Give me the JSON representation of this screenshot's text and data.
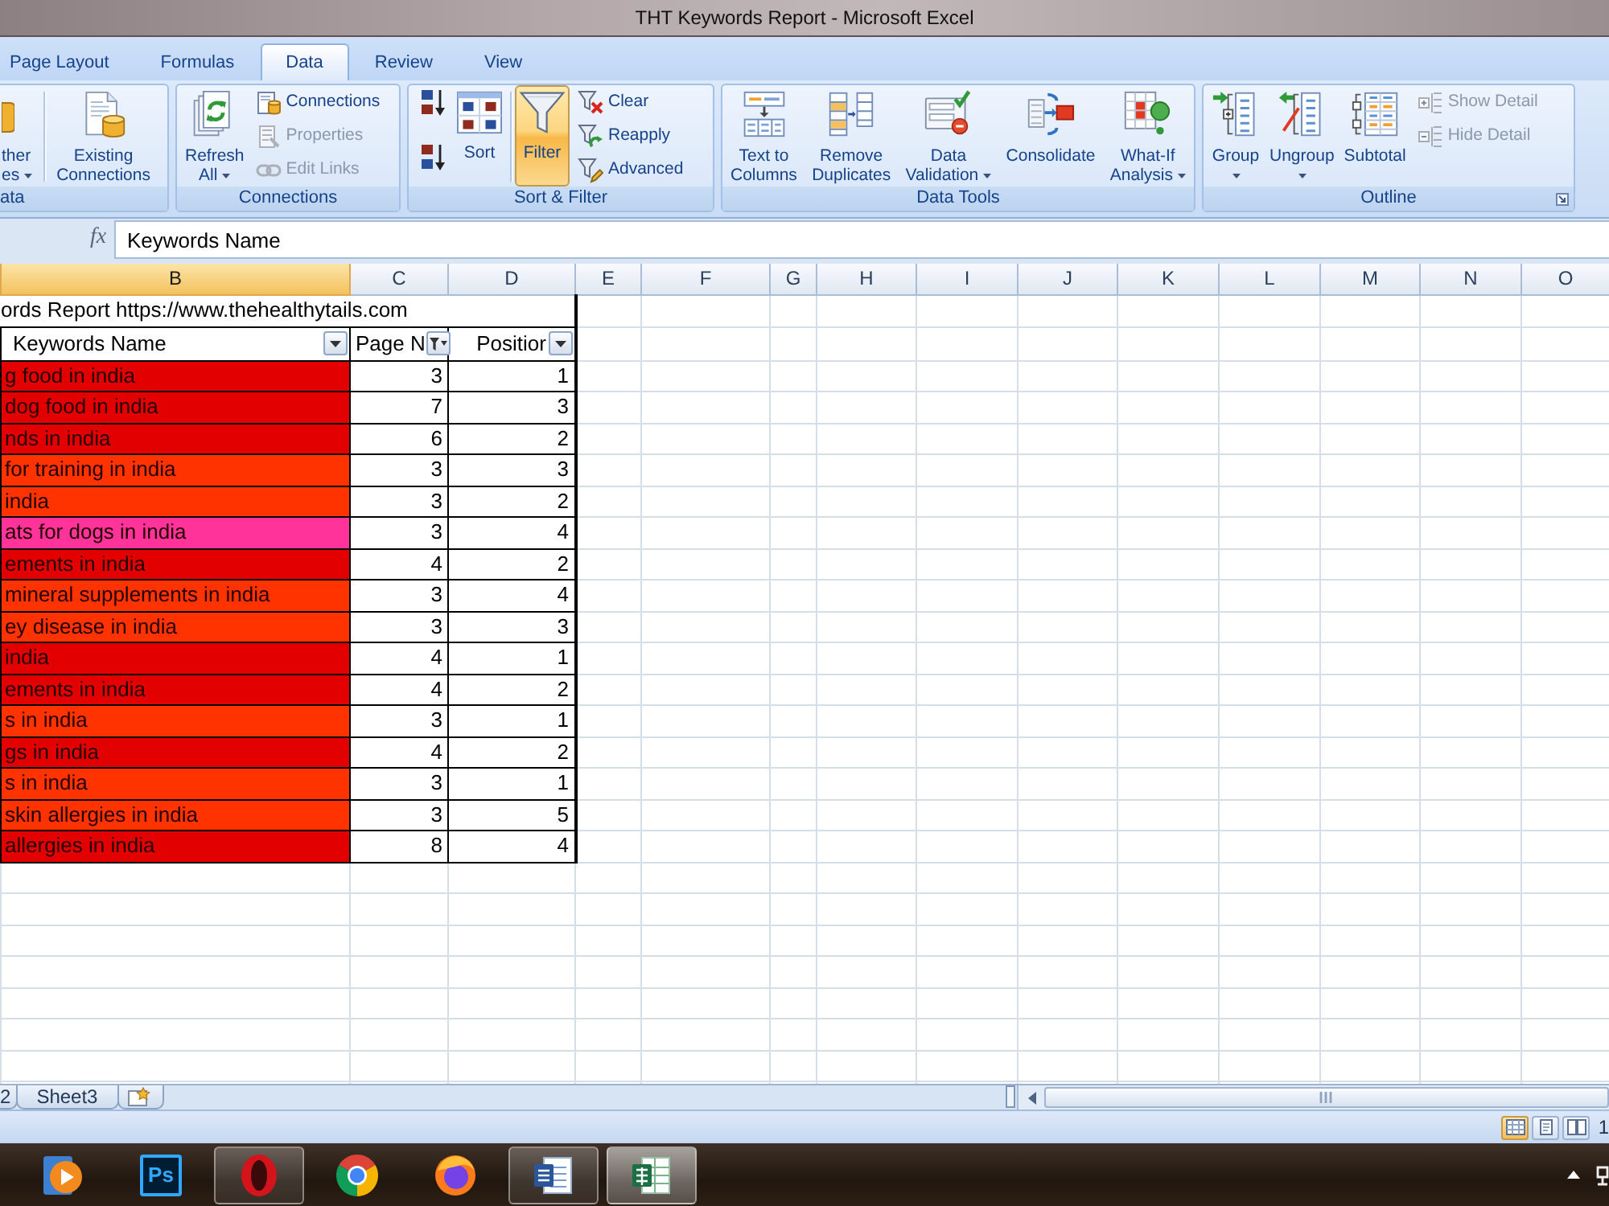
{
  "window": {
    "title": "THT Keywords Report - Microsoft Excel"
  },
  "ribbon_tabs": [
    {
      "label": "Page Layout",
      "selected": false
    },
    {
      "label": "Formulas",
      "selected": false
    },
    {
      "label": "Data",
      "selected": true
    },
    {
      "label": "Review",
      "selected": false
    },
    {
      "label": "View",
      "selected": false
    }
  ],
  "ribbon_groups": [
    {
      "label": "ata",
      "dialog_launcher": false,
      "items": [
        {
          "kind": "large",
          "lines": [
            "ther",
            "es"
          ],
          "dropdown": true,
          "disabled": false,
          "on": false
        },
        {
          "kind": "separator"
        },
        {
          "kind": "large",
          "lines": [
            "Existing",
            "Connections"
          ],
          "dropdown": false,
          "disabled": false,
          "on": false
        }
      ]
    },
    {
      "label": "Connections",
      "dialog_launcher": false,
      "items": [
        {
          "kind": "large",
          "lines": [
            "Refresh",
            "All"
          ],
          "dropdown": true,
          "disabled": false,
          "on": false
        },
        {
          "kind": "small",
          "lines": [
            "Connections"
          ],
          "disabled": false,
          "on": false
        },
        {
          "kind": "small",
          "lines": [
            "Properties"
          ],
          "disabled": true,
          "on": false
        },
        {
          "kind": "small",
          "lines": [
            "Edit Links"
          ],
          "disabled": true,
          "on": false
        }
      ]
    },
    {
      "label": "Sort & Filter",
      "dialog_launcher": false,
      "items": [
        {
          "kind": "icon",
          "disabled": false,
          "on": false
        },
        {
          "kind": "icon",
          "disabled": false,
          "on": false
        },
        {
          "kind": "large",
          "lines": [
            "Sort"
          ],
          "dropdown": false,
          "disabled": false,
          "on": false
        },
        {
          "kind": "separator"
        },
        {
          "kind": "large",
          "lines": [
            "Filter"
          ],
          "dropdown": false,
          "disabled": false,
          "on": true
        },
        {
          "kind": "small",
          "lines": [
            "Clear"
          ],
          "disabled": false,
          "on": false
        },
        {
          "kind": "small",
          "lines": [
            "Reapply"
          ],
          "disabled": false,
          "on": false
        },
        {
          "kind": "small",
          "lines": [
            "Advanced"
          ],
          "disabled": false,
          "on": false
        }
      ]
    },
    {
      "label": "Data Tools",
      "dialog_launcher": false,
      "items": [
        {
          "kind": "large",
          "lines": [
            "Text to",
            "Columns"
          ],
          "dropdown": false,
          "disabled": false,
          "on": false
        },
        {
          "kind": "large",
          "lines": [
            "Remove",
            "Duplicates"
          ],
          "dropdown": false,
          "disabled": false,
          "on": false
        },
        {
          "kind": "large",
          "lines": [
            "Data",
            "Validation"
          ],
          "dropdown": true,
          "disabled": false,
          "on": false
        },
        {
          "kind": "large",
          "lines": [
            "Consolidate"
          ],
          "dropdown": false,
          "disabled": false,
          "on": false
        },
        {
          "kind": "large",
          "lines": [
            "What-If",
            "Analysis"
          ],
          "dropdown": true,
          "disabled": false,
          "on": false
        }
      ]
    },
    {
      "label": "Outline",
      "dialog_launcher": true,
      "items": [
        {
          "kind": "large",
          "lines": [
            "Group"
          ],
          "dropdown": true,
          "disabled": false,
          "on": false
        },
        {
          "kind": "large",
          "lines": [
            "Ungroup"
          ],
          "dropdown": true,
          "disabled": false,
          "on": false
        },
        {
          "kind": "large",
          "lines": [
            "Subtotal"
          ],
          "dropdown": false,
          "disabled": false,
          "on": false
        },
        {
          "kind": "small",
          "lines": [
            "Show Detail"
          ],
          "disabled": true,
          "on": false
        },
        {
          "kind": "small",
          "lines": [
            "Hide Detail"
          ],
          "disabled": true,
          "on": false
        }
      ]
    }
  ],
  "formula_bar": {
    "insert_function": "fx",
    "formula": "Keywords Name"
  },
  "sheet": {
    "columns": [
      {
        "label": "B",
        "selected": true
      },
      {
        "label": "C",
        "selected": false
      },
      {
        "label": "D",
        "selected": false
      },
      {
        "label": "E",
        "selected": false
      },
      {
        "label": "F",
        "selected": false
      },
      {
        "label": "G",
        "selected": false
      },
      {
        "label": "H",
        "selected": false
      },
      {
        "label": "I",
        "selected": false
      },
      {
        "label": "J",
        "selected": false
      },
      {
        "label": "K",
        "selected": false
      },
      {
        "label": "L",
        "selected": false
      },
      {
        "label": "M",
        "selected": false
      },
      {
        "label": "N",
        "selected": false
      },
      {
        "label": "O",
        "selected": false
      }
    ],
    "title_row": "ords Report https://www.thehealthytails.com",
    "headers": [
      {
        "label": "Keywords Name",
        "filtered": false
      },
      {
        "label": "Page N",
        "filtered": true
      },
      {
        "label": "Positior",
        "filtered": false
      }
    ],
    "rows": [
      {
        "cells": [
          "g food in india",
          "3",
          "1"
        ],
        "color": "#e30000"
      },
      {
        "cells": [
          "dog food in india",
          "7",
          "3"
        ],
        "color": "#e30000"
      },
      {
        "cells": [
          "nds in india",
          "6",
          "2"
        ],
        "color": "#e30000"
      },
      {
        "cells": [
          "for training in india",
          "3",
          "3"
        ],
        "color": "#ff3300"
      },
      {
        "cells": [
          "india",
          "3",
          "2"
        ],
        "color": "#ff3300"
      },
      {
        "cells": [
          "ats for dogs in india",
          "3",
          "4"
        ],
        "color": "#ff3399"
      },
      {
        "cells": [
          "ements in india",
          "4",
          "2"
        ],
        "color": "#e30000"
      },
      {
        "cells": [
          "mineral supplements in india",
          "3",
          "4"
        ],
        "color": "#ff3300"
      },
      {
        "cells": [
          "ey disease in india",
          "3",
          "3"
        ],
        "color": "#ff3300"
      },
      {
        "cells": [
          "india",
          "4",
          "1"
        ],
        "color": "#e30000"
      },
      {
        "cells": [
          "ements in india",
          "4",
          "2"
        ],
        "color": "#e30000"
      },
      {
        "cells": [
          "s in india",
          "3",
          "1"
        ],
        "color": "#ff3300"
      },
      {
        "cells": [
          "gs in india",
          "4",
          "2"
        ],
        "color": "#e30000"
      },
      {
        "cells": [
          "s in india",
          "3",
          "1"
        ],
        "color": "#ff3300"
      },
      {
        "cells": [
          "skin allergies in india",
          "3",
          "5"
        ],
        "color": "#ff3300"
      },
      {
        "cells": [
          "allergies in india",
          "8",
          "4"
        ],
        "color": "#e30000"
      }
    ]
  },
  "sheet_tabs": [
    {
      "label": "2",
      "selected": false
    },
    {
      "label": "Sheet3",
      "selected": false
    }
  ],
  "status_bar": {
    "view_buttons": [
      {
        "selected": true
      },
      {
        "selected": false
      },
      {
        "selected": false
      }
    ],
    "zoom": "1"
  },
  "taskbar": {
    "apps": [
      {
        "running": false,
        "selected": false
      },
      {
        "label": "Ps",
        "running": false,
        "selected": false
      },
      {
        "running": true,
        "selected": false
      },
      {
        "running": false,
        "selected": false
      },
      {
        "running": false,
        "selected": false
      },
      {
        "running": true,
        "selected": false
      },
      {
        "running": true,
        "selected": true
      }
    ]
  }
}
